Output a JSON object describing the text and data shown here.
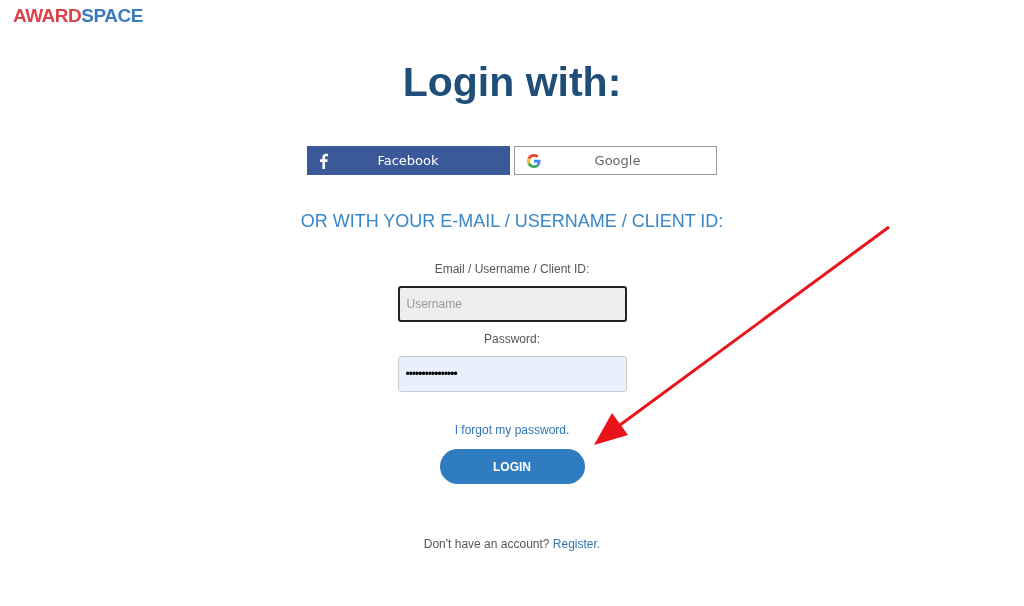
{
  "logo": {
    "parts": [
      {
        "text": "AWARD",
        "color": "#d9434b"
      },
      {
        "text": "SPACE",
        "color": "#3a7bbf"
      }
    ]
  },
  "title": "Login with:",
  "social_buttons": [
    {
      "kind": "facebook",
      "label": "Facebook"
    },
    {
      "kind": "google",
      "label": "Google"
    }
  ],
  "subheading": "OR WITH YOUR E-MAIL / USERNAME / CLIENT ID:",
  "fields": [
    {
      "label": "Email / Username / Client ID:",
      "placeholder": "Username",
      "focused": true,
      "autofilled": false
    },
    {
      "label": "Password:",
      "value": "••••••••••••••••",
      "focused": false,
      "autofilled": true
    }
  ],
  "forgot_link": "I forgot my password.",
  "login_button": "LOGIN",
  "register": {
    "text": "Don't have an account?",
    "link": "Register."
  }
}
